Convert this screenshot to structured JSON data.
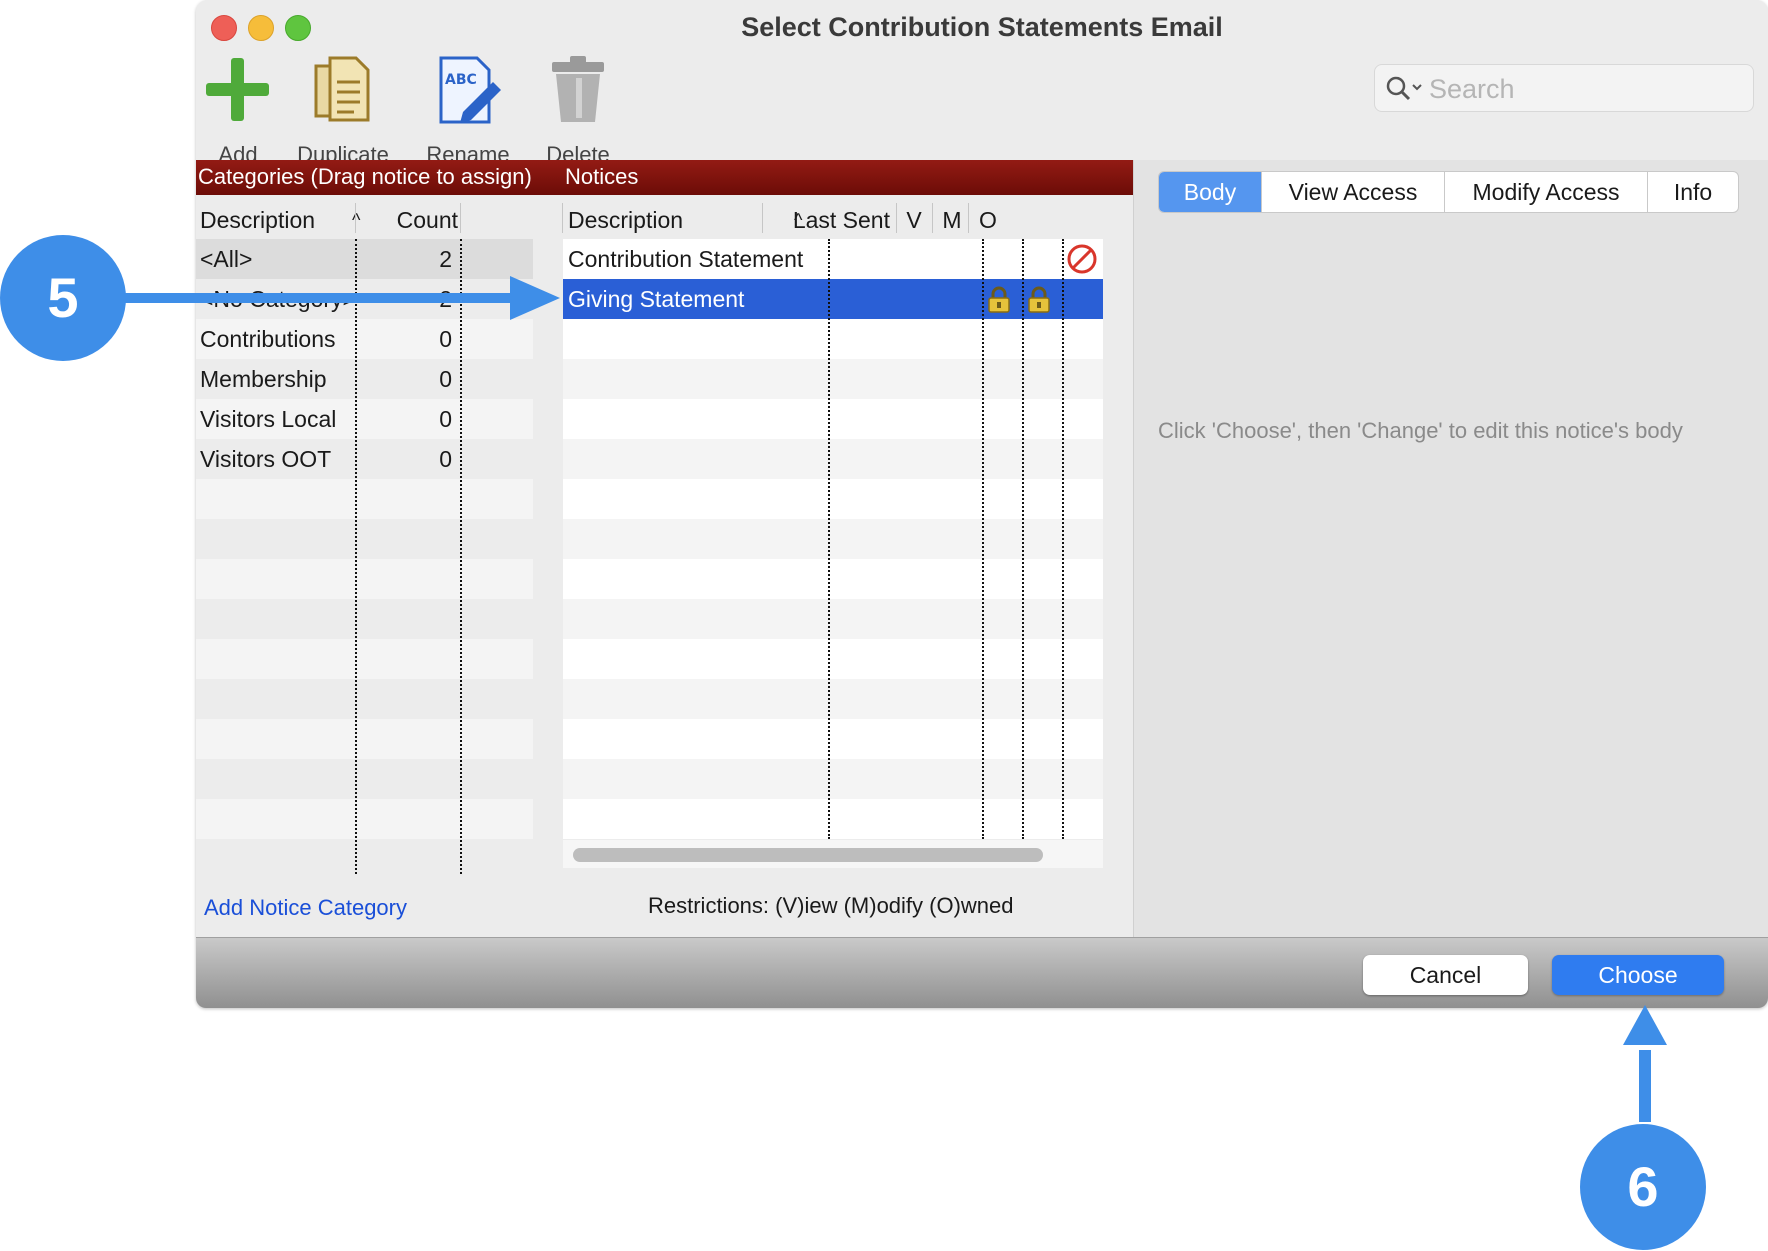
{
  "window": {
    "title": "Select Contribution Statements Email"
  },
  "toolbar": {
    "add_label": "Add",
    "duplicate_label": "Duplicate",
    "rename_label": "Rename",
    "delete_label": "Delete"
  },
  "search": {
    "placeholder": "Search"
  },
  "categories_panel": {
    "header": "Categories (Drag notice to assign)",
    "col_description": "Description",
    "col_count": "Count",
    "rows": [
      {
        "description": "<All>",
        "count": "2"
      },
      {
        "description": "<No Category>",
        "count": "2"
      },
      {
        "description": "Contributions",
        "count": "0"
      },
      {
        "description": "Membership",
        "count": "0"
      },
      {
        "description": "Visitors Local",
        "count": "0"
      },
      {
        "description": "Visitors OOT",
        "count": "0"
      }
    ],
    "add_link": "Add Notice Category"
  },
  "notices_panel": {
    "header": "Notices",
    "col_description": "Description",
    "col_last_sent": "Last Sent",
    "col_v": "V",
    "col_m": "M",
    "col_o": "O",
    "rows": [
      {
        "description": "Contribution Statement",
        "last_sent": "",
        "owned_icon": "prohibited-icon"
      },
      {
        "description": "Giving Statement",
        "last_sent": "",
        "view_icon": "lock-icon",
        "modify_icon": "lock-icon",
        "selected": true
      }
    ],
    "restrictions": "Restrictions: (V)iew (M)odify (O)wned"
  },
  "detail_tabs": [
    {
      "label": "Body",
      "active": true
    },
    {
      "label": "View Access"
    },
    {
      "label": "Modify Access"
    },
    {
      "label": "Info"
    }
  ],
  "body_hint": "Click 'Choose', then 'Change' to edit this notice's body",
  "footer": {
    "cancel_label": "Cancel",
    "choose_label": "Choose"
  },
  "callouts": {
    "step_a": "5",
    "step_b": "6"
  },
  "colors": {
    "accent": "#2f7cf0",
    "selection": "#2a5fd6",
    "category_bar": "#7d120c",
    "callout": "#3e8ee8",
    "link": "#1a4fd8"
  }
}
